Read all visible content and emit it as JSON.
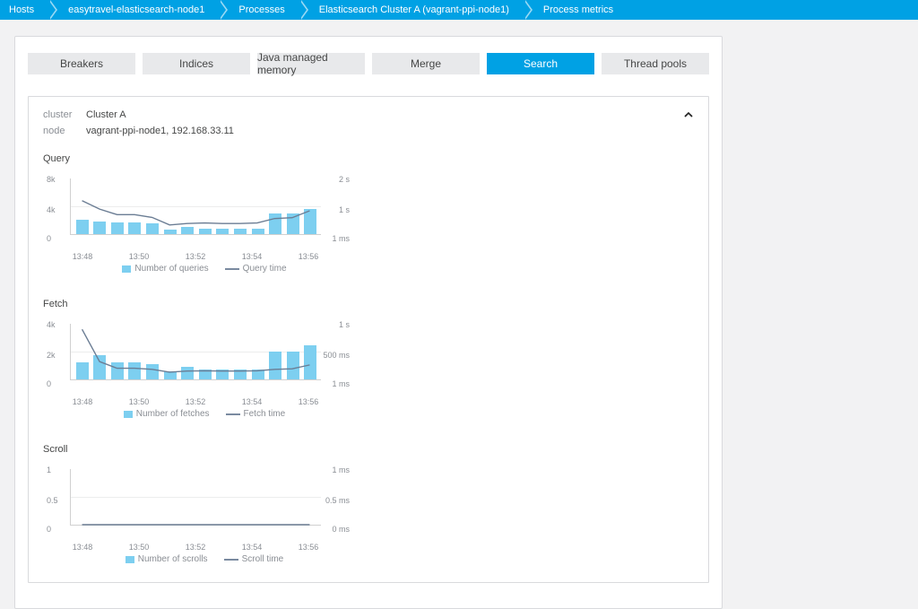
{
  "breadcrumbs": [
    "Hosts",
    "easytravel-elasticsearch-node1",
    "Processes",
    "Elasticsearch Cluster A (vagrant-ppi-node1)",
    "Process metrics"
  ],
  "tabs": [
    {
      "id": "breakers",
      "label": "Breakers",
      "active": false
    },
    {
      "id": "indices",
      "label": "Indices",
      "active": false
    },
    {
      "id": "jmm",
      "label": "Java managed memory",
      "active": false
    },
    {
      "id": "merge",
      "label": "Merge",
      "active": false
    },
    {
      "id": "search",
      "label": "Search",
      "active": true
    },
    {
      "id": "threadpools",
      "label": "Thread pools",
      "active": false
    }
  ],
  "info": {
    "cluster_label": "cluster",
    "cluster_value": "Cluster A",
    "node_label": "node",
    "node_value": "vagrant-ppi-node1, 192.168.33.11"
  },
  "charts": {
    "query": {
      "title": "Query",
      "legend_bar": "Number of queries",
      "legend_line": "Query time",
      "yl": [
        "8k",
        "4k",
        "0"
      ],
      "yr": [
        "2 s",
        "1 s",
        "1 ms"
      ]
    },
    "fetch": {
      "title": "Fetch",
      "legend_bar": "Number of fetches",
      "legend_line": "Fetch time",
      "yl": [
        "4k",
        "2k",
        "0"
      ],
      "yr": [
        "1 s",
        "500 ms",
        "1 ms"
      ]
    },
    "scroll": {
      "title": "Scroll",
      "legend_bar": "Number of scrolls",
      "legend_line": "Scroll time",
      "yl": [
        "1",
        "0.5",
        "0"
      ],
      "yr": [
        "1 ms",
        "0.5 ms",
        "0 ms"
      ]
    }
  },
  "chart_data": [
    {
      "id": "query",
      "type": "bar+line",
      "title": "Query",
      "x": [
        "13:48",
        "13:50",
        "13:52",
        "13:54",
        "13:56"
      ],
      "bars_raw": [
        2000,
        1800,
        1700,
        1700,
        1600,
        700,
        1000,
        800,
        800,
        800,
        800,
        2900,
        2900,
        3600
      ],
      "bar_unit": "queries",
      "bar_ylim": [
        0,
        8000
      ],
      "line_raw": [
        1200,
        900,
        700,
        700,
        600,
        330,
        380,
        400,
        380,
        380,
        400,
        560,
        590,
        840
      ],
      "line_unit": "ms",
      "line_ylim": [
        0,
        2000
      ]
    },
    {
      "id": "fetch",
      "type": "bar+line",
      "title": "Fetch",
      "x": [
        "13:48",
        "13:50",
        "13:52",
        "13:54",
        "13:56"
      ],
      "bars_raw": [
        1200,
        1700,
        1200,
        1200,
        1100,
        600,
        900,
        700,
        700,
        700,
        700,
        2000,
        2000,
        2400
      ],
      "bar_unit": "fetches",
      "bar_ylim": [
        0,
        4000
      ],
      "line_raw": [
        900,
        320,
        200,
        200,
        180,
        130,
        150,
        155,
        150,
        150,
        155,
        180,
        190,
        260
      ],
      "line_unit": "ms",
      "line_ylim": [
        0,
        1000
      ]
    },
    {
      "id": "scroll",
      "type": "bar+line",
      "title": "Scroll",
      "x": [
        "13:48",
        "13:50",
        "13:52",
        "13:54",
        "13:56"
      ],
      "bars_raw": [
        0,
        0,
        0,
        0,
        0,
        0,
        0,
        0,
        0,
        0,
        0,
        0,
        0,
        0
      ],
      "bar_unit": "scrolls",
      "bar_ylim": [
        0,
        1
      ],
      "line_raw": [
        0,
        0,
        0,
        0,
        0,
        0,
        0,
        0,
        0,
        0,
        0,
        0,
        0,
        0
      ],
      "line_unit": "ms",
      "line_ylim": [
        0,
        1
      ]
    }
  ]
}
